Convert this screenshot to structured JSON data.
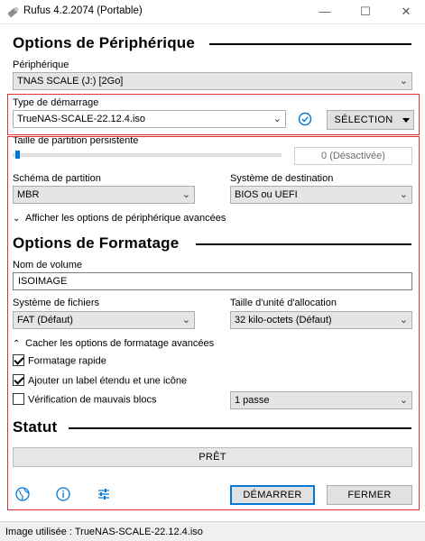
{
  "window": {
    "title": "Rufus 4.2.2074 (Portable)",
    "minimize_glyph": "—",
    "maximize_glyph": "☐",
    "close_glyph": "✕"
  },
  "device_options": {
    "section_title": "Options de Périphérique",
    "device_label": "Périphérique",
    "device_value": "TNAS SCALE (J:) [2Go]",
    "boot_type_label": "Type de démarrage",
    "boot_type_value": "TrueNAS-SCALE-22.12.4.iso",
    "select_button": "SÉLECTION",
    "persistent_label": "Taille de partition persistente",
    "persistent_value": "0 (Désactivée)",
    "partition_scheme_label": "Schéma de partition",
    "partition_scheme_value": "MBR",
    "target_system_label": "Système de destination",
    "target_system_value": "BIOS ou UEFI",
    "advanced_toggle": "Afficher les options de périphérique avancées"
  },
  "format_options": {
    "section_title": "Options de Formatage",
    "volume_label": "Nom de volume",
    "volume_value": "ISOIMAGE",
    "filesystem_label": "Système de fichiers",
    "filesystem_value": "FAT (Défaut)",
    "cluster_label": "Taille d'unité d'allocation",
    "cluster_value": "32 kilo-octets (Défaut)",
    "advanced_toggle": "Cacher les options de formatage avancées",
    "quick_format_label": "Formatage rapide",
    "quick_format_checked": true,
    "extended_label": "Ajouter un label étendu et une icône",
    "extended_checked": true,
    "bad_blocks_label": "Vérification de mauvais blocs",
    "bad_blocks_checked": false,
    "passes_value": "1 passe"
  },
  "status": {
    "section_title": "Statut",
    "status_text": "PRÊT"
  },
  "actions": {
    "start_button": "DÉMARRER",
    "close_button": "FERMER"
  },
  "footer": {
    "image_text": "Image utilisée : TrueNAS-SCALE-22.12.4.iso"
  },
  "colors": {
    "accent": "#0078d7",
    "highlight": "#e03030"
  }
}
